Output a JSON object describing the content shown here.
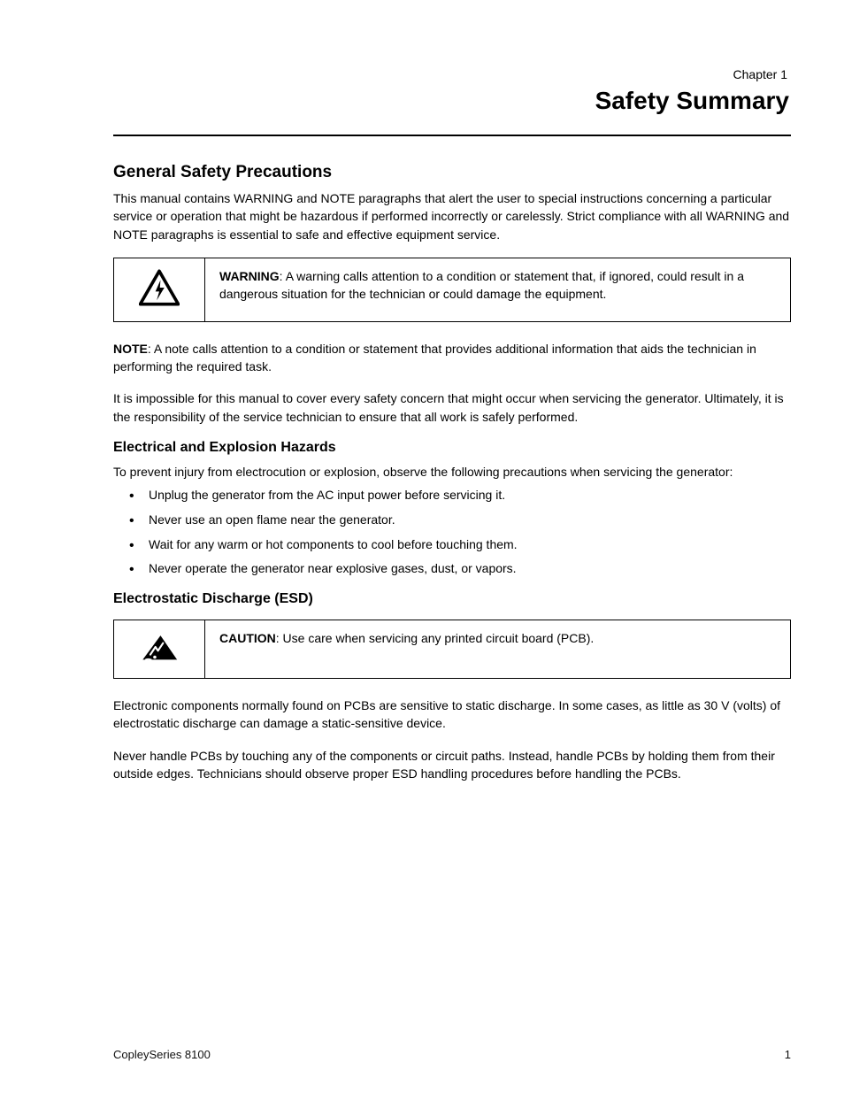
{
  "header": {
    "chapter_line": "Chapter 1",
    "title": "Safety Summary"
  },
  "sections": {
    "general_safety": {
      "heading": "General Safety Precautions",
      "p1": "This manual contains WARNING and NOTE paragraphs that alert the user to special instructions concerning a particular service or operation that might be hazardous if performed incorrectly or carelessly. Strict compliance with all WARNING and NOTE paragraphs is essential to safe and effective equipment service.",
      "warning": {
        "label": "WARNING",
        "text": "A warning calls attention to a condition or statement that, if ignored, could result in a dangerous situation for the technician or could damage the equipment."
      },
      "note": {
        "label": "NOTE",
        "text": "A note calls attention to a condition or statement that provides additional information that aids the technician in performing the required task."
      },
      "p_closing": "It is impossible for this manual to cover every safety concern that might occur when servicing the generator. Ultimately, it is the responsibility of the service technician to ensure that all work is safely performed."
    },
    "explosion_hazards": {
      "heading": "Electrical and Explosion Hazards",
      "intro": "To prevent injury from electrocution or explosion, observe the following precautions when servicing the generator:",
      "bullets": [
        "Unplug the generator from the AC input power before servicing it.",
        "Never use an open flame near the generator.",
        "Wait for any warm or hot components to cool before touching them.",
        "Never operate the generator near explosive gases, dust, or vapors."
      ]
    },
    "esd": {
      "heading": "Electrostatic Discharge (ESD)",
      "callout": {
        "label": "CAUTION",
        "text": ": Use care when servicing any printed circuit board (PCB)."
      },
      "p1": "Electronic components normally found on PCBs are sensitive to static discharge. In some cases, as little as 30 V (volts) of electrostatic discharge can damage a static-sensitive device.",
      "p2": "Never handle PCBs by touching any of the components or circuit paths. Instead, handle PCBs by holding them from their outside edges. Technicians should observe proper ESD handling procedures before handling the PCBs."
    }
  },
  "footer": {
    "left": "CopleySeries 8100",
    "right": "1"
  }
}
